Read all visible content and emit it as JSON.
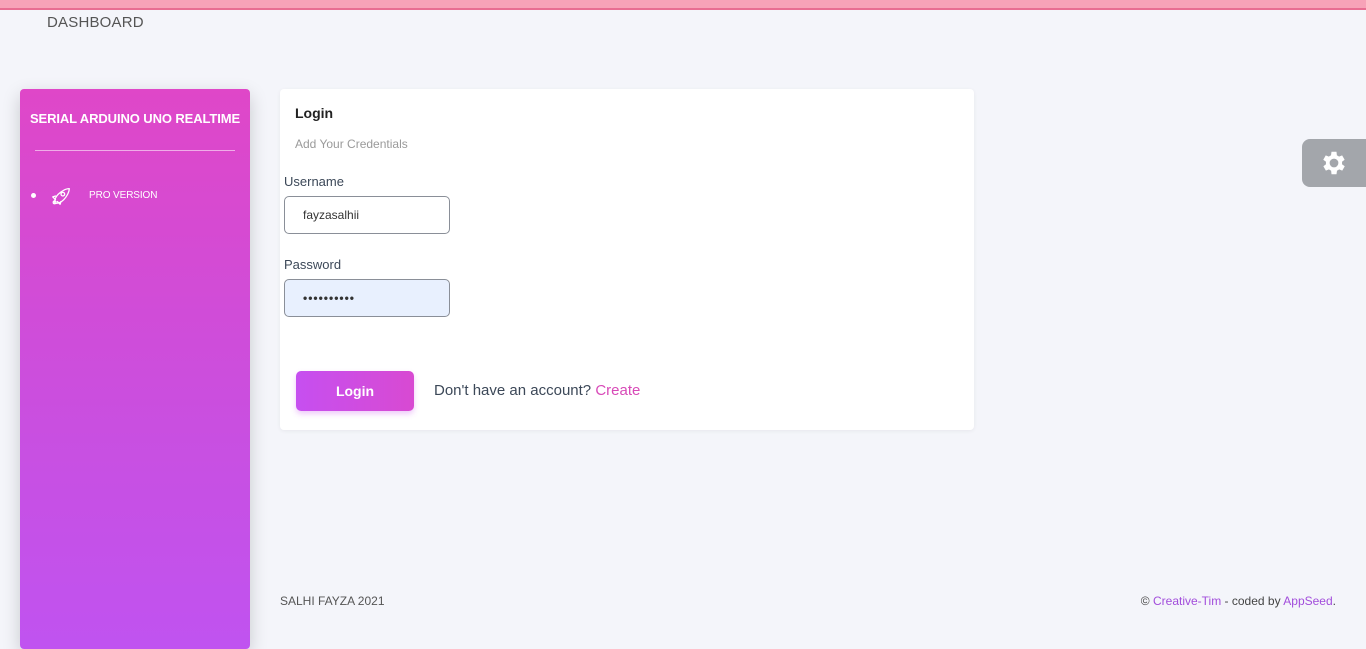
{
  "header": {
    "brand": "DASHBOARD"
  },
  "sidebar": {
    "title": "SERIAL ARDUINO UNO REALTIME",
    "items": [
      {
        "label": "PRO VERSION",
        "icon": "rocket-icon"
      }
    ]
  },
  "login_card": {
    "title": "Login",
    "subtitle": "Add Your Credentials",
    "username": {
      "label": "Username",
      "value": "fayzasalhii"
    },
    "password": {
      "label": "Password",
      "value": "••••••••••"
    },
    "submit_label": "Login",
    "signup_prompt": "Don't have an account?",
    "signup_link": "Create"
  },
  "settings": {
    "icon": "gear-icon"
  },
  "footer": {
    "left": "SALHI FAYZA 2021",
    "copyright": "©",
    "creative_tim": "Creative-Tim",
    "coded_by": " - coded by ",
    "appseed": "AppSeed",
    "period": "."
  },
  "colors": {
    "accent": "#c64ff0",
    "sidebar_top": "#df47c8",
    "sidebar_bottom": "#c053f0",
    "link": "#d84ab8",
    "top_strip": "#f7a2b8"
  }
}
